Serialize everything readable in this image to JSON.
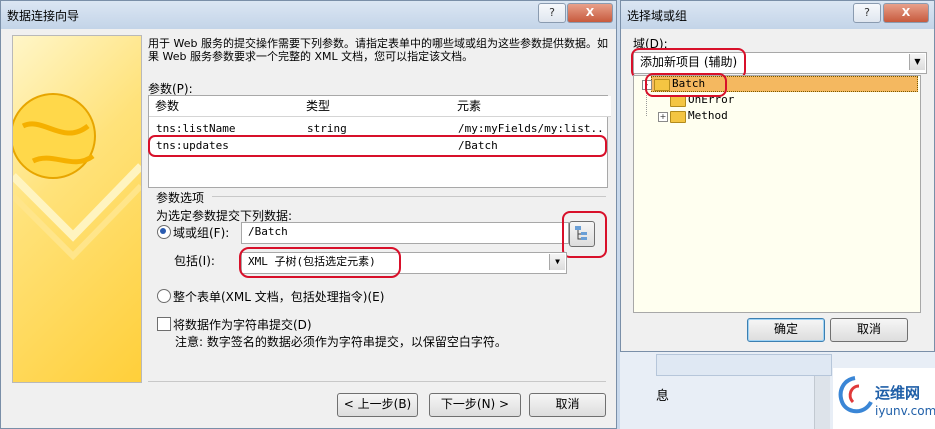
{
  "wizard": {
    "title": "数据连接向导",
    "help_btn": "?",
    "close_btn": "X",
    "description": "用于 Web 服务的提交操作需要下列参数。请指定表单中的哪些域或组为这些参数提供数据。如果 Web 服务参数要求一个完整的 XML 文档，您可以指定该文档。",
    "params_label": "参数(P):",
    "table": {
      "headers": [
        "参数",
        "类型",
        "元素"
      ],
      "rows": [
        [
          "tns:listName",
          "string",
          "/my:myFields/my:list..."
        ],
        [
          "tns:updates",
          "",
          "/Batch"
        ]
      ]
    },
    "options": {
      "group_label": "参数选项",
      "submit_label": "为选定参数提交下列数据:",
      "field_radio": "域或组(F):",
      "field_value": "/Batch",
      "include_label": "包括(I):",
      "include_value": "XML 子树(包括选定元素)",
      "form_radio": "整个表单(XML 文档，包括处理指令)(E)",
      "string_check": "将数据作为字符串提交(D)",
      "note": "注意: 数字签名的数据必须作为字符串提交，以保留空白字符。"
    },
    "buttons": {
      "back": "< 上一步(B)",
      "next": "下一步(N) >",
      "cancel": "取消"
    }
  },
  "background": {
    "info_text": "息"
  },
  "selector": {
    "title": "选择域或组",
    "help_btn": "?",
    "close_btn": "X",
    "domain_label": "域(D):",
    "domain_value": "添加新项目 (辅助)",
    "tree": [
      {
        "label": "Batch",
        "expander": "-",
        "selected": true
      },
      {
        "label": "OnError",
        "expander": "",
        "selected": false
      },
      {
        "label": "Method",
        "expander": "+",
        "selected": false
      }
    ],
    "ok": "确定",
    "cancel": "取消"
  },
  "watermark": {
    "line1": "运维网",
    "line2": "iyunv.com"
  },
  "colors": {
    "highlight": "#d8102a",
    "selection": "#f4b860"
  }
}
